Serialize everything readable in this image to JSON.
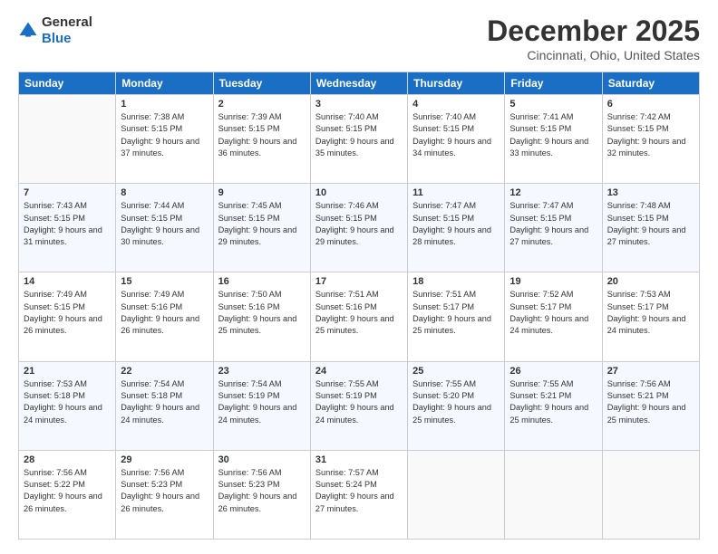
{
  "header": {
    "logo_general": "General",
    "logo_blue": "Blue",
    "month_title": "December 2025",
    "location": "Cincinnati, Ohio, United States"
  },
  "days_of_week": [
    "Sunday",
    "Monday",
    "Tuesday",
    "Wednesday",
    "Thursday",
    "Friday",
    "Saturday"
  ],
  "weeks": [
    [
      {
        "day": "",
        "sunrise": "",
        "sunset": "",
        "daylight": ""
      },
      {
        "day": "1",
        "sunrise": "Sunrise: 7:38 AM",
        "sunset": "Sunset: 5:15 PM",
        "daylight": "Daylight: 9 hours and 37 minutes."
      },
      {
        "day": "2",
        "sunrise": "Sunrise: 7:39 AM",
        "sunset": "Sunset: 5:15 PM",
        "daylight": "Daylight: 9 hours and 36 minutes."
      },
      {
        "day": "3",
        "sunrise": "Sunrise: 7:40 AM",
        "sunset": "Sunset: 5:15 PM",
        "daylight": "Daylight: 9 hours and 35 minutes."
      },
      {
        "day": "4",
        "sunrise": "Sunrise: 7:40 AM",
        "sunset": "Sunset: 5:15 PM",
        "daylight": "Daylight: 9 hours and 34 minutes."
      },
      {
        "day": "5",
        "sunrise": "Sunrise: 7:41 AM",
        "sunset": "Sunset: 5:15 PM",
        "daylight": "Daylight: 9 hours and 33 minutes."
      },
      {
        "day": "6",
        "sunrise": "Sunrise: 7:42 AM",
        "sunset": "Sunset: 5:15 PM",
        "daylight": "Daylight: 9 hours and 32 minutes."
      }
    ],
    [
      {
        "day": "7",
        "sunrise": "Sunrise: 7:43 AM",
        "sunset": "Sunset: 5:15 PM",
        "daylight": "Daylight: 9 hours and 31 minutes."
      },
      {
        "day": "8",
        "sunrise": "Sunrise: 7:44 AM",
        "sunset": "Sunset: 5:15 PM",
        "daylight": "Daylight: 9 hours and 30 minutes."
      },
      {
        "day": "9",
        "sunrise": "Sunrise: 7:45 AM",
        "sunset": "Sunset: 5:15 PM",
        "daylight": "Daylight: 9 hours and 29 minutes."
      },
      {
        "day": "10",
        "sunrise": "Sunrise: 7:46 AM",
        "sunset": "Sunset: 5:15 PM",
        "daylight": "Daylight: 9 hours and 29 minutes."
      },
      {
        "day": "11",
        "sunrise": "Sunrise: 7:47 AM",
        "sunset": "Sunset: 5:15 PM",
        "daylight": "Daylight: 9 hours and 28 minutes."
      },
      {
        "day": "12",
        "sunrise": "Sunrise: 7:47 AM",
        "sunset": "Sunset: 5:15 PM",
        "daylight": "Daylight: 9 hours and 27 minutes."
      },
      {
        "day": "13",
        "sunrise": "Sunrise: 7:48 AM",
        "sunset": "Sunset: 5:15 PM",
        "daylight": "Daylight: 9 hours and 27 minutes."
      }
    ],
    [
      {
        "day": "14",
        "sunrise": "Sunrise: 7:49 AM",
        "sunset": "Sunset: 5:15 PM",
        "daylight": "Daylight: 9 hours and 26 minutes."
      },
      {
        "day": "15",
        "sunrise": "Sunrise: 7:49 AM",
        "sunset": "Sunset: 5:16 PM",
        "daylight": "Daylight: 9 hours and 26 minutes."
      },
      {
        "day": "16",
        "sunrise": "Sunrise: 7:50 AM",
        "sunset": "Sunset: 5:16 PM",
        "daylight": "Daylight: 9 hours and 25 minutes."
      },
      {
        "day": "17",
        "sunrise": "Sunrise: 7:51 AM",
        "sunset": "Sunset: 5:16 PM",
        "daylight": "Daylight: 9 hours and 25 minutes."
      },
      {
        "day": "18",
        "sunrise": "Sunrise: 7:51 AM",
        "sunset": "Sunset: 5:17 PM",
        "daylight": "Daylight: 9 hours and 25 minutes."
      },
      {
        "day": "19",
        "sunrise": "Sunrise: 7:52 AM",
        "sunset": "Sunset: 5:17 PM",
        "daylight": "Daylight: 9 hours and 24 minutes."
      },
      {
        "day": "20",
        "sunrise": "Sunrise: 7:53 AM",
        "sunset": "Sunset: 5:17 PM",
        "daylight": "Daylight: 9 hours and 24 minutes."
      }
    ],
    [
      {
        "day": "21",
        "sunrise": "Sunrise: 7:53 AM",
        "sunset": "Sunset: 5:18 PM",
        "daylight": "Daylight: 9 hours and 24 minutes."
      },
      {
        "day": "22",
        "sunrise": "Sunrise: 7:54 AM",
        "sunset": "Sunset: 5:18 PM",
        "daylight": "Daylight: 9 hours and 24 minutes."
      },
      {
        "day": "23",
        "sunrise": "Sunrise: 7:54 AM",
        "sunset": "Sunset: 5:19 PM",
        "daylight": "Daylight: 9 hours and 24 minutes."
      },
      {
        "day": "24",
        "sunrise": "Sunrise: 7:55 AM",
        "sunset": "Sunset: 5:19 PM",
        "daylight": "Daylight: 9 hours and 24 minutes."
      },
      {
        "day": "25",
        "sunrise": "Sunrise: 7:55 AM",
        "sunset": "Sunset: 5:20 PM",
        "daylight": "Daylight: 9 hours and 25 minutes."
      },
      {
        "day": "26",
        "sunrise": "Sunrise: 7:55 AM",
        "sunset": "Sunset: 5:21 PM",
        "daylight": "Daylight: 9 hours and 25 minutes."
      },
      {
        "day": "27",
        "sunrise": "Sunrise: 7:56 AM",
        "sunset": "Sunset: 5:21 PM",
        "daylight": "Daylight: 9 hours and 25 minutes."
      }
    ],
    [
      {
        "day": "28",
        "sunrise": "Sunrise: 7:56 AM",
        "sunset": "Sunset: 5:22 PM",
        "daylight": "Daylight: 9 hours and 26 minutes."
      },
      {
        "day": "29",
        "sunrise": "Sunrise: 7:56 AM",
        "sunset": "Sunset: 5:23 PM",
        "daylight": "Daylight: 9 hours and 26 minutes."
      },
      {
        "day": "30",
        "sunrise": "Sunrise: 7:56 AM",
        "sunset": "Sunset: 5:23 PM",
        "daylight": "Daylight: 9 hours and 26 minutes."
      },
      {
        "day": "31",
        "sunrise": "Sunrise: 7:57 AM",
        "sunset": "Sunset: 5:24 PM",
        "daylight": "Daylight: 9 hours and 27 minutes."
      },
      {
        "day": "",
        "sunrise": "",
        "sunset": "",
        "daylight": ""
      },
      {
        "day": "",
        "sunrise": "",
        "sunset": "",
        "daylight": ""
      },
      {
        "day": "",
        "sunrise": "",
        "sunset": "",
        "daylight": ""
      }
    ]
  ]
}
